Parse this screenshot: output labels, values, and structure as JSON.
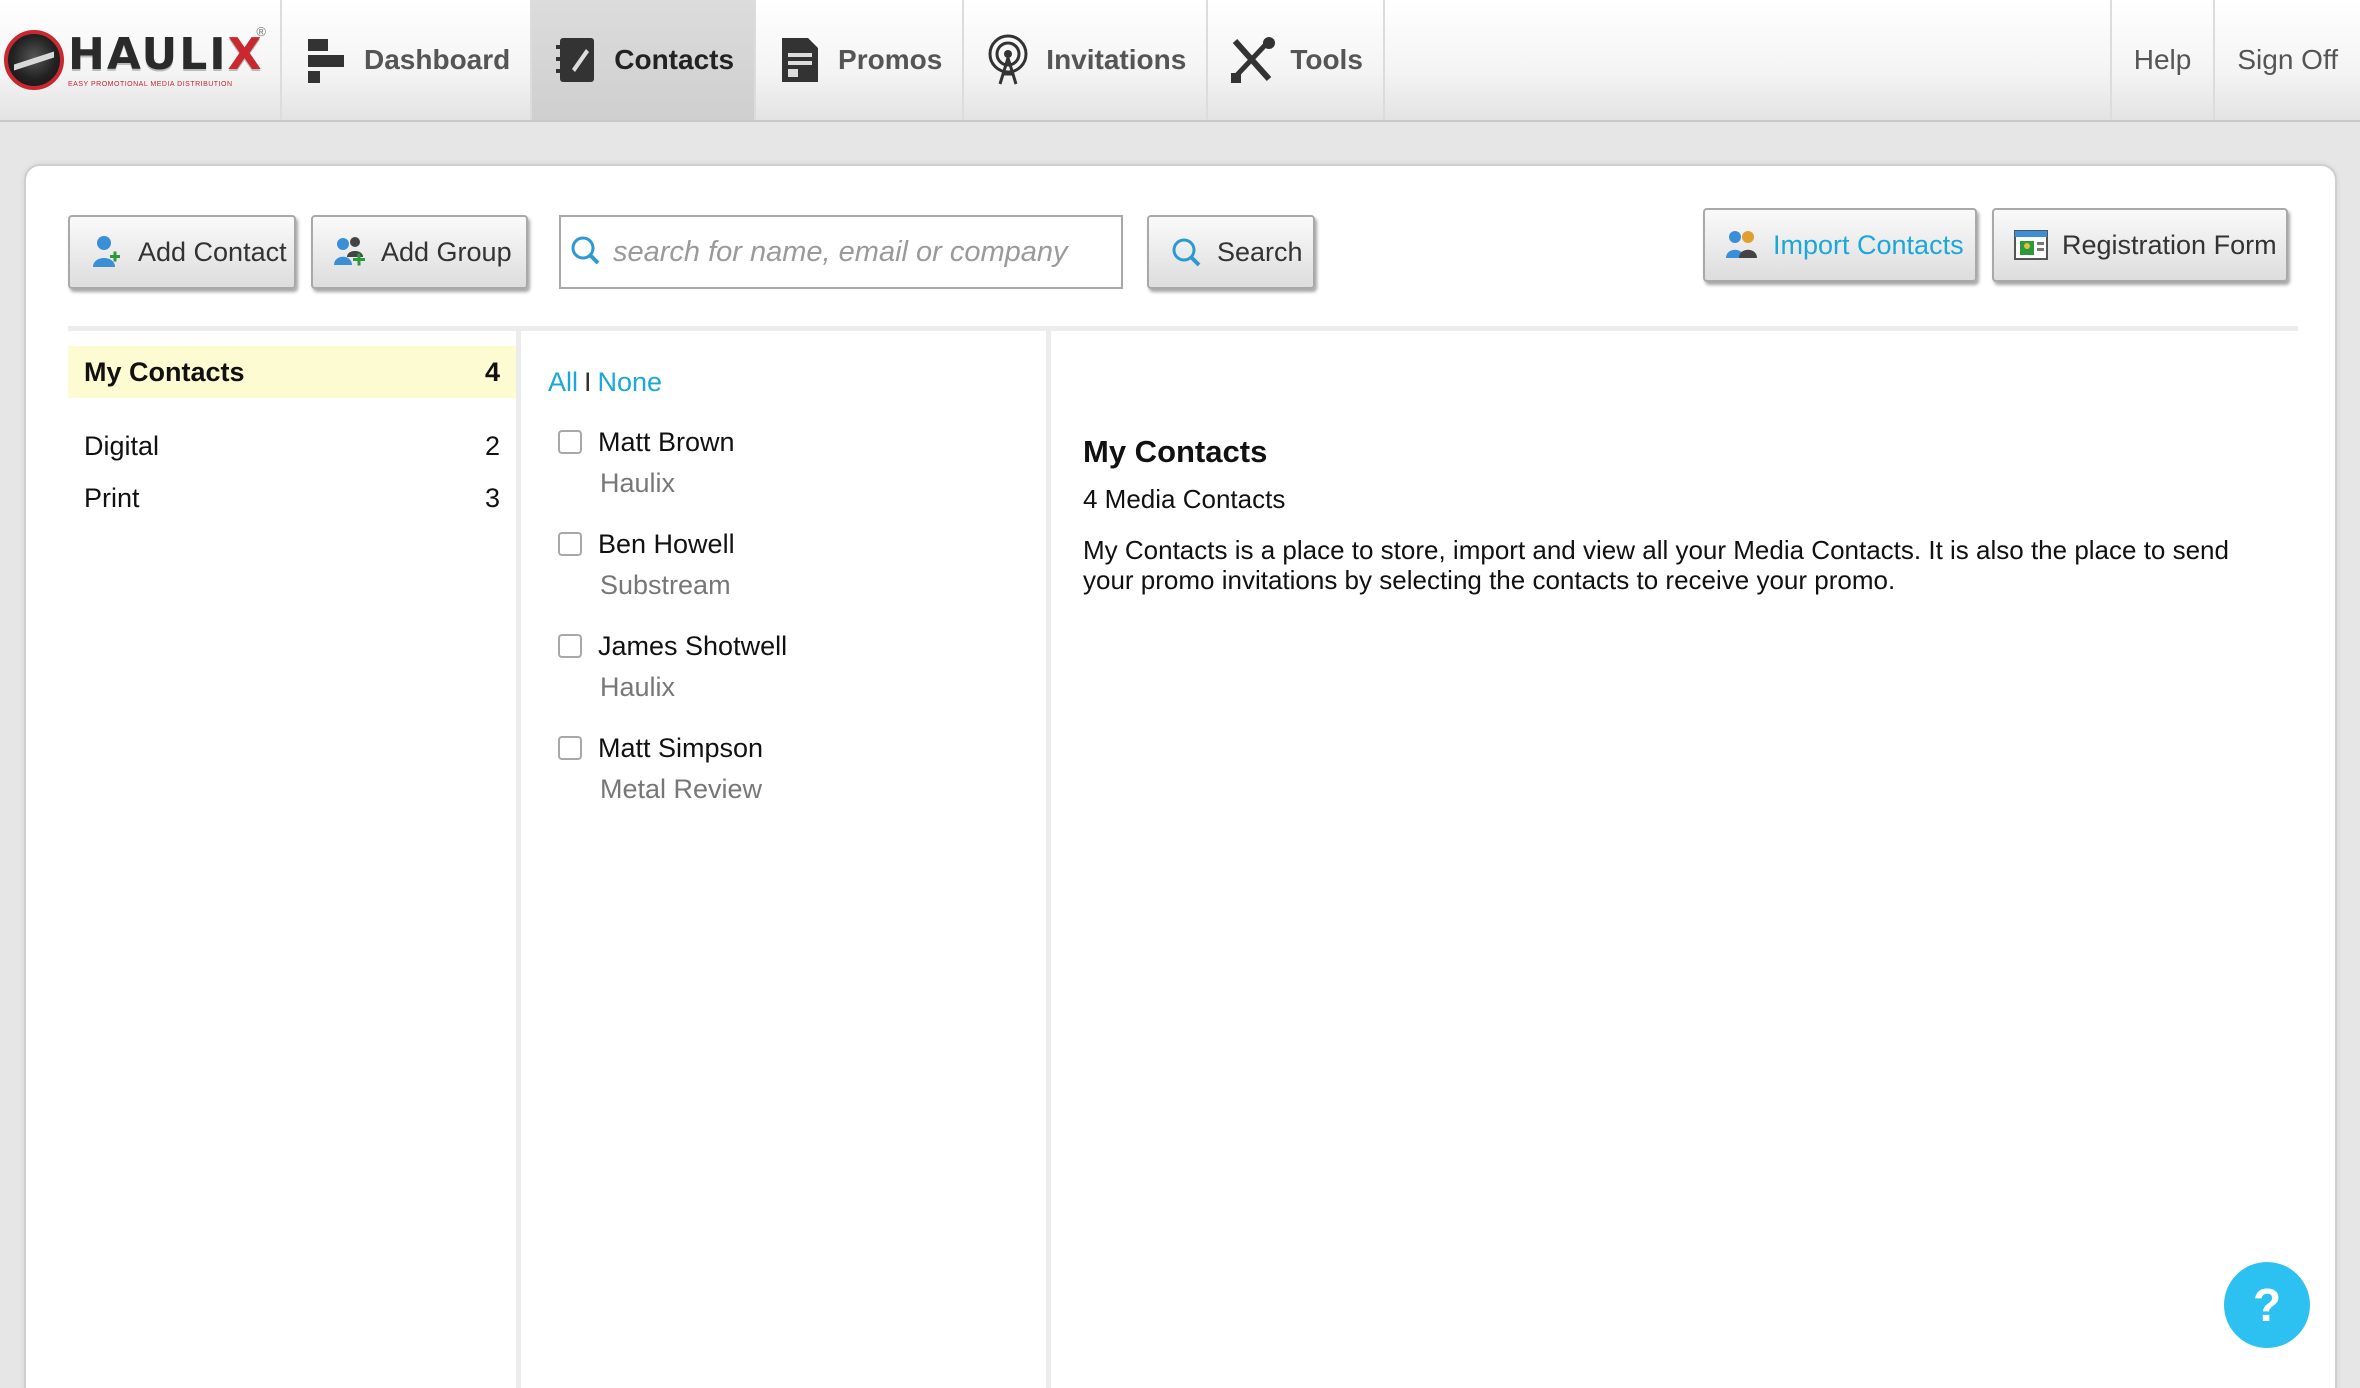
{
  "brand": {
    "name_main": "HAULI",
    "name_x": "X",
    "tagline": "EASY PROMOTIONAL MEDIA DISTRIBUTION",
    "registered": "®",
    "accent": "#c8282e"
  },
  "nav": {
    "items": [
      {
        "label": "Dashboard",
        "icon": "dashboard-icon"
      },
      {
        "label": "Contacts",
        "icon": "contacts-book-icon",
        "active": true
      },
      {
        "label": "Promos",
        "icon": "promos-icon"
      },
      {
        "label": "Invitations",
        "icon": "broadcast-tower-icon"
      },
      {
        "label": "Tools",
        "icon": "tools-icon"
      }
    ],
    "help": "Help",
    "signoff": "Sign Off"
  },
  "toolbar": {
    "add_contact": "Add Contact",
    "add_group": "Add Group",
    "search_placeholder": "search for name, email or company",
    "search_value": "",
    "search_button": "Search",
    "import_contacts": "Import Contacts",
    "registration_form": "Registration Form",
    "link_color": "#1aa7d9"
  },
  "groups": [
    {
      "name": "My Contacts",
      "count": "4",
      "selected": true
    },
    {
      "name": "Digital",
      "count": "2"
    },
    {
      "name": "Print",
      "count": "3"
    }
  ],
  "select": {
    "all": "All",
    "sep": "I",
    "none": "None"
  },
  "contacts": [
    {
      "name": "Matt Brown",
      "company": "Haulix"
    },
    {
      "name": "Ben Howell",
      "company": "Substream"
    },
    {
      "name": "James Shotwell",
      "company": "Haulix"
    },
    {
      "name": "Matt Simpson",
      "company": "Metal Review"
    }
  ],
  "detail": {
    "title": "My Contacts",
    "count": "4 Media Contacts",
    "description": "My Contacts is a place to store, import and view all your Media Contacts. It is also the place to send your promo invitations by selecting the contacts to receive your promo."
  },
  "help_fab": "?"
}
